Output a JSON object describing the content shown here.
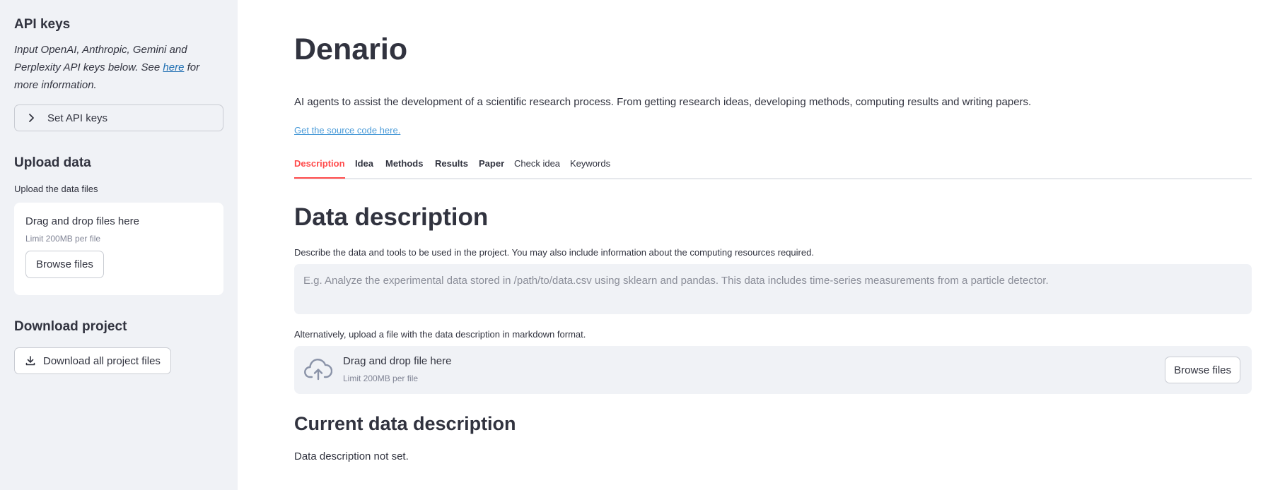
{
  "sidebar": {
    "api_keys": {
      "heading": "API keys",
      "text_before": "Input OpenAI, Anthropic, Gemini and Perplexity API keys below. See ",
      "link": "here",
      "text_after": " for more information.",
      "expander_label": "Set API keys"
    },
    "upload": {
      "heading": "Upload data",
      "label": "Upload the data files",
      "drop_text": "Drag and drop files here",
      "limit": "Limit 200MB per file",
      "browse_label": "Browse files"
    },
    "download": {
      "heading": "Download project",
      "button_label": "Download all project files"
    }
  },
  "main": {
    "title": "Denario",
    "subtitle": "AI agents to assist the development of a scientific research process. From getting research ideas, developing methods, computing results and writing papers.",
    "source_link": "Get the source code here",
    "source_link_suffix": ".",
    "tabs": [
      {
        "label": "Description"
      },
      {
        "label": "Idea"
      },
      {
        "label": "Methods"
      },
      {
        "label": "Results"
      },
      {
        "label": "Paper"
      },
      {
        "label": "Check idea"
      },
      {
        "label": "Keywords"
      }
    ],
    "active_tab": "Description",
    "section_title": "Data description",
    "description_label": "Describe the data and tools to be used in the project. You may also include information about the computing resources required.",
    "textarea": {
      "placeholder": "E.g. Analyze the experimental data stored in /path/to/data.csv using sklearn and pandas. This data includes time-series measurements from a particle detector.",
      "value": ""
    },
    "alt_label": "Alternatively, upload a file with the data description in markdown format.",
    "dropzone": {
      "drop_text": "Drag and drop file here",
      "limit": "Limit 200MB per file",
      "browse_label": "Browse files"
    },
    "current_title": "Current data description",
    "current_text": "Data description not set."
  },
  "colors": {
    "accent": "#ff4b4b",
    "sidebar_bg": "#f0f2f6",
    "link": "#1f6fb2",
    "text": "#31333f"
  }
}
